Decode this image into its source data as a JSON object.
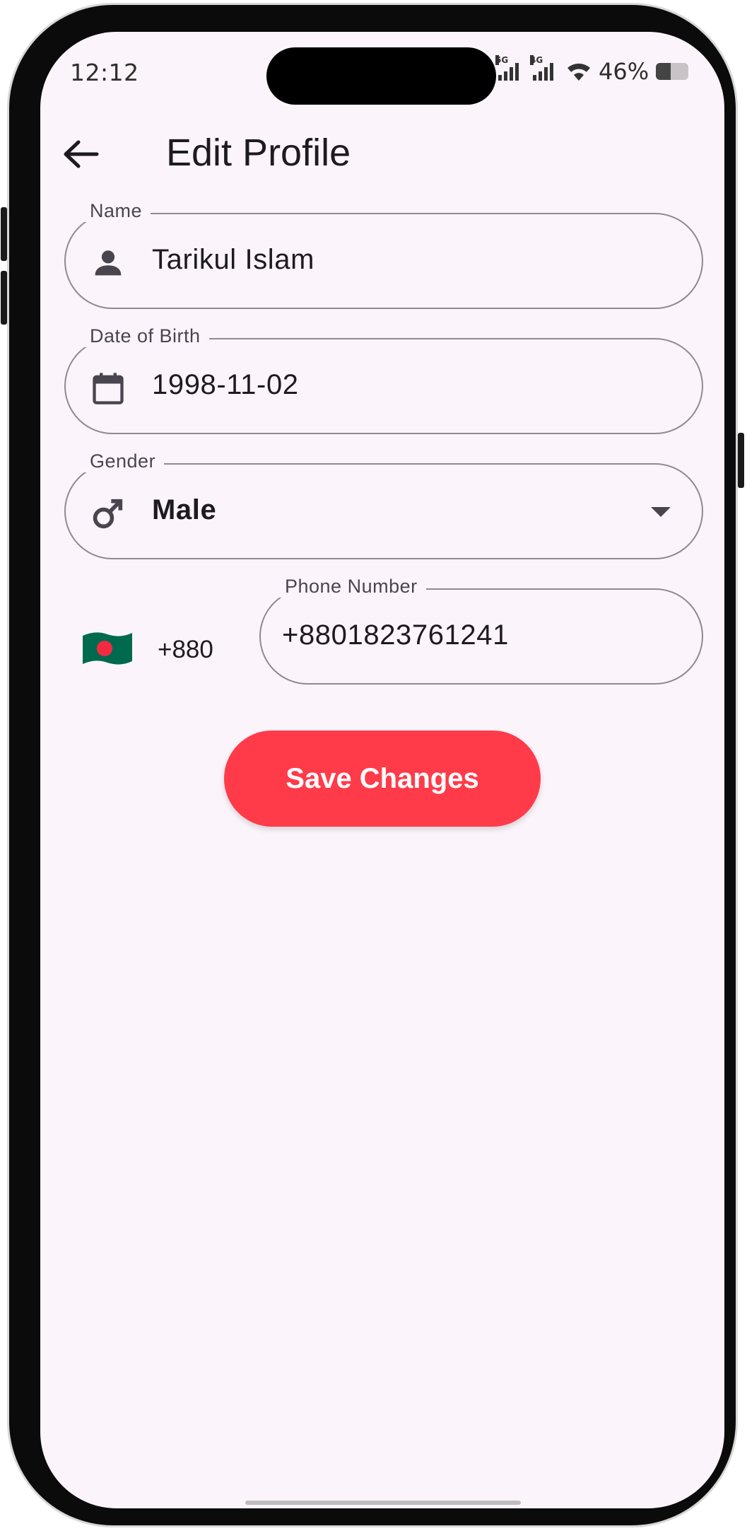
{
  "status_bar": {
    "time": "12:12",
    "network_1": "5G",
    "network_2": "4G",
    "battery_percent": "46%",
    "battery_level": 0.46
  },
  "header": {
    "back_icon": "arrow-left-icon",
    "title": "Edit Profile"
  },
  "form": {
    "name": {
      "label": "Name",
      "value": "Tarikul Islam",
      "icon": "person-icon"
    },
    "dob": {
      "label": "Date of Birth",
      "value": "1998-11-02",
      "icon": "calendar-icon"
    },
    "gender": {
      "label": "Gender",
      "value": "Male",
      "icon": "male-icon",
      "dropdown_icon": "caret-down-icon"
    },
    "phone": {
      "country_flag": "bangladesh-flag-icon",
      "country_code": "+880",
      "label": "Phone Number",
      "value": "+8801823761241"
    }
  },
  "actions": {
    "save_label": "Save Changes"
  },
  "colors": {
    "background": "#fcf4fb",
    "accent": "#ff3b4a",
    "outline": "#8f8a90",
    "text": "#1d1b20",
    "label": "#49454f",
    "flag_green": "#006a4e",
    "flag_red": "#f42a41"
  }
}
